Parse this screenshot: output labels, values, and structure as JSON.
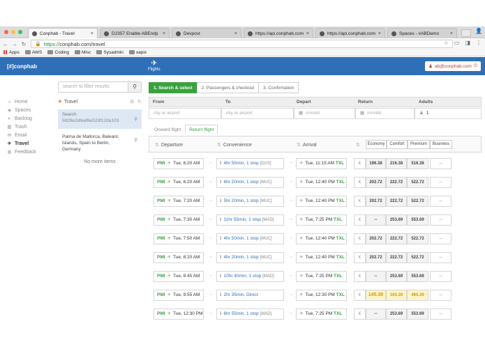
{
  "browser": {
    "tabs": [
      {
        "title": "Conphab - Travel",
        "active": true
      },
      {
        "title": "D2357 Enable ABEndp",
        "active": false
      },
      {
        "title": "Devpost",
        "active": false
      },
      {
        "title": "https://api.conphab.com/at",
        "active": false
      },
      {
        "title": "https://api.conphab.com/at",
        "active": false
      },
      {
        "title": "Spaces - #ABDemo",
        "active": false
      }
    ],
    "url_scheme": "https://",
    "url_rest": "conphab.com/travel",
    "bookmarks": [
      "Apps",
      "AWS",
      "Coding",
      "Misc",
      "Sysadmin",
      "xapix"
    ]
  },
  "app": {
    "brand": "[#]conphab",
    "section_label": "Flights",
    "user_email": "ab@conphab.com"
  },
  "nav": [
    {
      "label": "Home",
      "icon": "home-icon",
      "glyph": "⌂",
      "active": false
    },
    {
      "label": "Spaces",
      "icon": "spaces-icon",
      "glyph": "◈",
      "active": false
    },
    {
      "label": "Backlog",
      "icon": "backlog-icon",
      "glyph": "◐",
      "active": false
    },
    {
      "label": "Trash",
      "icon": "trash-icon",
      "glyph": "▥",
      "active": false
    },
    {
      "label": "Email",
      "icon": "email-icon",
      "glyph": "✉",
      "active": false
    },
    {
      "label": "Travel",
      "icon": "plane-icon",
      "glyph": "✈",
      "active": true
    },
    {
      "label": "Feedback",
      "icon": "feedback-icon",
      "glyph": "◍",
      "active": false
    }
  ],
  "filter": {
    "placeholder": "search to filter results"
  },
  "travel_panel": {
    "title": "Travel",
    "search_label": "Search",
    "search_id": "5829e2dfeaf6e52df12da103",
    "saved_search": "Palma de Mallorca, Balearic Islands, Spain to Berlin, Germany",
    "no_more": "No more items"
  },
  "steps": [
    "1. Search & select",
    "2. Passengers & checkout",
    "3. Confirmation"
  ],
  "form": {
    "from_label": "From",
    "to_label": "To",
    "depart_label": "Depart",
    "return_label": "Return",
    "adults_label": "Adults",
    "from_placeholder": "city or airport",
    "to_placeholder": "city or airport",
    "depart_placeholder": "mm/dd",
    "return_placeholder": "mm/dd",
    "adults_value": "1"
  },
  "subtabs": [
    "Onward flight",
    "Return flight"
  ],
  "table": {
    "departure_header": "Departure",
    "convenience_header": "Convenience",
    "arrival_header": "Arrival",
    "classes": [
      "Economy",
      "Comfort",
      "Premium",
      "Business"
    ],
    "currency": "€",
    "rows": [
      {
        "from": "PMI",
        "dep": "Tue, 6:20 AM",
        "dur": "4hr 55min, 1 stop",
        "via": "[DUS]",
        "arr": "Tue, 11:15 AM",
        "to": "TXL",
        "eco": "196.38",
        "com": "216.38",
        "pre": "516.38",
        "bus": "--",
        "hl": false
      },
      {
        "from": "PMI",
        "dep": "Tue, 6:20 AM",
        "dur": "6hr 20min, 1 stop",
        "via": "[MUC]",
        "arr": "Tue, 12:40 PM",
        "to": "TXL",
        "eco": "202.72",
        "com": "222.72",
        "pre": "522.72",
        "bus": "--",
        "hl": false
      },
      {
        "from": "PMI",
        "dep": "Tue, 7:20 AM",
        "dur": "5hr 20min, 1 stop",
        "via": "[MUC]",
        "arr": "Tue, 12:40 PM",
        "to": "TXL",
        "eco": "202.72",
        "com": "222.72",
        "pre": "522.72",
        "bus": "--",
        "hl": false
      },
      {
        "from": "PMI",
        "dep": "Tue, 7:30 AM",
        "dur": "11hr 55min, 1 stop",
        "via": "[MAD]",
        "arr": "Tue, 7:25 PM",
        "to": "TXL",
        "eco": "--",
        "com": "253.69",
        "pre": "553.69",
        "bus": "--",
        "hl": false
      },
      {
        "from": "PMI",
        "dep": "Tue, 7:50 AM",
        "dur": "4hr 50min, 1 stop",
        "via": "[MUC]",
        "arr": "Tue, 12:40 PM",
        "to": "TXL",
        "eco": "202.72",
        "com": "222.72",
        "pre": "522.72",
        "bus": "--",
        "hl": false
      },
      {
        "from": "PMI",
        "dep": "Tue, 8:20 AM",
        "dur": "4hr 20min, 1 stop",
        "via": "[MUC]",
        "arr": "Tue, 12:40 PM",
        "to": "TXL",
        "eco": "202.72",
        "com": "222.72",
        "pre": "522.72",
        "bus": "--",
        "hl": false
      },
      {
        "from": "PMI",
        "dep": "Tue, 8:45 AM",
        "dur": "10hr 40min, 1 stop",
        "via": "[MAD]",
        "arr": "Tue, 7:25 PM",
        "to": "TXL",
        "eco": "--",
        "com": "253.69",
        "pre": "553.69",
        "bus": "--",
        "hl": false
      },
      {
        "from": "PMI",
        "dep": "Tue, 9:55 AM",
        "dur": "2hr 35min, Direct",
        "via": "",
        "arr": "Tue, 12:30 PM",
        "to": "TXL",
        "eco": "145.39",
        "com": "165.39",
        "pre": "465.39",
        "bus": "--",
        "hl": true
      },
      {
        "from": "PMI",
        "dep": "Tue, 12:30 PM",
        "dur": "6hr 55min, 1 stop",
        "via": "[MAD]",
        "arr": "Tue, 7:25 PM",
        "to": "TXL",
        "eco": "--",
        "com": "253.69",
        "pre": "553.69",
        "bus": "--",
        "hl": false
      }
    ]
  }
}
